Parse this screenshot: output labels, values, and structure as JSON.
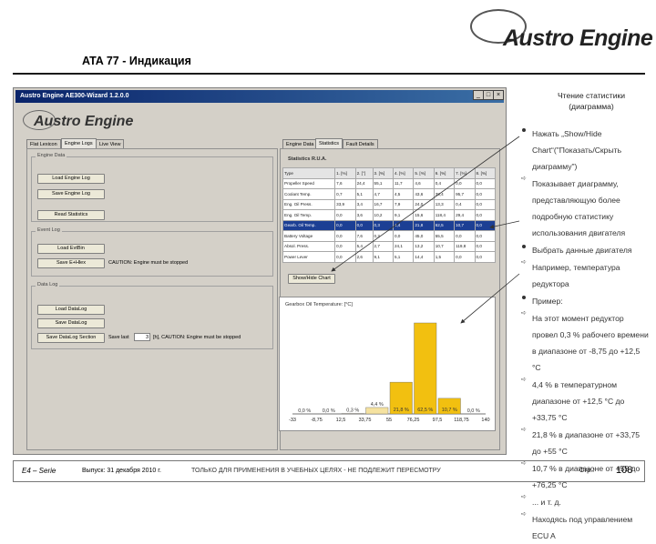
{
  "brand": {
    "logo_text": "Austro Engine"
  },
  "slide": {
    "title": "ATA 77 - Индикация",
    "footer": {
      "series": "E4 – Serie",
      "issue": "Выпуск: 31 декабря 2010 г.",
      "notice": "ТОЛЬКО ДЛЯ ПРИМЕНЕНИЯ В УЧЕБНЫХ ЦЕЛЯХ - НЕ ПОДЛЕЖИТ ПЕРЕСМОТРУ",
      "page_label": "Стр.:",
      "page_number": "108"
    }
  },
  "window": {
    "title": "Austro Engine AE300-Wizard 1.2.0.0",
    "logo": "Austro Engine",
    "left_tabs": [
      "Flat Lexicon",
      "Engine Logs",
      "Live View"
    ],
    "right_tabs": [
      "Engine Data",
      "Statistics",
      "Fault Details"
    ],
    "engine_group": {
      "title": "Engine Data",
      "buttons": [
        "Load Engine Log",
        "Save Engine Log",
        "Read Statistics"
      ]
    },
    "fault_group": {
      "title": "Event Log",
      "buttons": [
        "Load EvtBin",
        "Save E+Hlex"
      ],
      "caution": "CAUTION: Engine must be stopped"
    },
    "data_group": {
      "title": "Data Log",
      "buttons": [
        "Load DataLog",
        "Save DataLog",
        "Save DataLog Section"
      ],
      "save_last_label": "Save last",
      "save_last_value": "3",
      "caution": "[h], CAUTION: Engine must be stopped"
    },
    "stats_label": "Statistics R.U.A.",
    "table": {
      "headers": [
        "Type",
        "1. [%]",
        "2. [°]",
        "3. [%]",
        "4. [%]",
        "5. [%]",
        "6. [%]",
        "7. [%]",
        "8. [%]"
      ],
      "rows": [
        [
          "Propeller Speed",
          "7,6",
          "24,4",
          "55,1",
          "11,7",
          "4,6",
          "0,4",
          "0,0",
          "0,0"
        ],
        [
          "Coolant Temp.",
          "0,7",
          "5,1",
          "4,7",
          "4,5",
          "43,6",
          "38,4",
          "95,7",
          "0,0"
        ],
        [
          "Eng. Oil Press.",
          "33,9",
          "3,4",
          "16,7",
          "7,9",
          "24,0",
          "13,3",
          "0,4",
          "0,0"
        ],
        [
          "Eng. Oil Temp.",
          "0,0",
          "3,6",
          "10,2",
          "9,1",
          "15,6",
          "118,4",
          "29,4",
          "0,0"
        ],
        [
          "Gearb. Oil Temp.",
          "0,0",
          "0,0",
          "0,3",
          "4,4",
          "21,8",
          "62,5",
          "10,7",
          "0,0"
        ],
        [
          "Battery Voltage",
          "0,0",
          "7,6",
          "0,2",
          "0,0",
          "45,0",
          "55,5",
          "0,0",
          "0,0"
        ],
        [
          "Absol. Press.",
          "0,0",
          "5,4",
          "2,7",
          "24,1",
          "13,2",
          "10,7",
          "119,8",
          "0,0"
        ],
        [
          "Power Lever",
          "0,0",
          "2,6",
          "9,1",
          "5,1",
          "14,4",
          "1,5",
          "0,0",
          "0,0"
        ]
      ],
      "selected_row": 4
    },
    "show_hide_button": "Show/Hide Chart",
    "chart": {
      "title": "Gearbox Oil Temperature: [°C]",
      "labels": [
        "0,0 %",
        "0,0 %",
        "0,3 %",
        "4,4 %",
        "21,8 %",
        "62,5 %",
        "10,7 %",
        "0,0 %"
      ]
    }
  },
  "chart_data": {
    "type": "bar",
    "title": "Gearbox Oil Temperature: [°C]",
    "x_ticks": [
      "-33",
      "-8,75",
      "12,5",
      "33,75",
      "55",
      "76,25",
      "97,5",
      "118,75",
      "140"
    ],
    "categories": [
      "-33..-8,75",
      "-8,75..12,5",
      "12,5..33,75",
      "33,75..55",
      "55..76,25",
      "76,25..97,5",
      "97,5..118,75",
      "118,75..140"
    ],
    "values": [
      0.0,
      0.0,
      0.3,
      4.4,
      21.8,
      62.5,
      10.7,
      0.0
    ],
    "ylim": [
      0,
      70
    ],
    "grid": false,
    "colors": {
      "bar": "#f2c010",
      "bar_low": "#f5e2a0",
      "stroke": "#666666"
    }
  },
  "notes": {
    "heading": "Чтение статистики",
    "subheading": "(диаграмма)",
    "items": [
      {
        "kind": "bullet",
        "text": "Нажать „Show/Hide Chart“(\"Показать/Скрыть диаграмму\")"
      },
      {
        "kind": "arrow",
        "text": "Показывает диаграмму, представляющую более подробную статистику использования двигателя"
      },
      {
        "kind": "bullet",
        "text": "Выбрать данные двигателя"
      },
      {
        "kind": "arrow",
        "text": "Например, температура редуктора"
      },
      {
        "kind": "bullet",
        "text": "Пример:"
      },
      {
        "kind": "arrow",
        "text": "На этот момент редуктор провел 0,3 % рабочего времени в диапазоне от -8,75 до +12,5 °C"
      },
      {
        "kind": "arrow",
        "text": "4,4 % в температурном диапазоне от +12,5 °C до +33,75 °C"
      },
      {
        "kind": "arrow",
        "text": "21,8 % в диапазоне от +33,75 до +55 °C"
      },
      {
        "kind": "arrow",
        "text": "10,7 % в диапазоне от +55 до +76,25 °C"
      },
      {
        "kind": "arrow",
        "text": "... и т. д."
      },
      {
        "kind": "arrow",
        "text": "Находясь под управлением ECU A"
      }
    ]
  }
}
